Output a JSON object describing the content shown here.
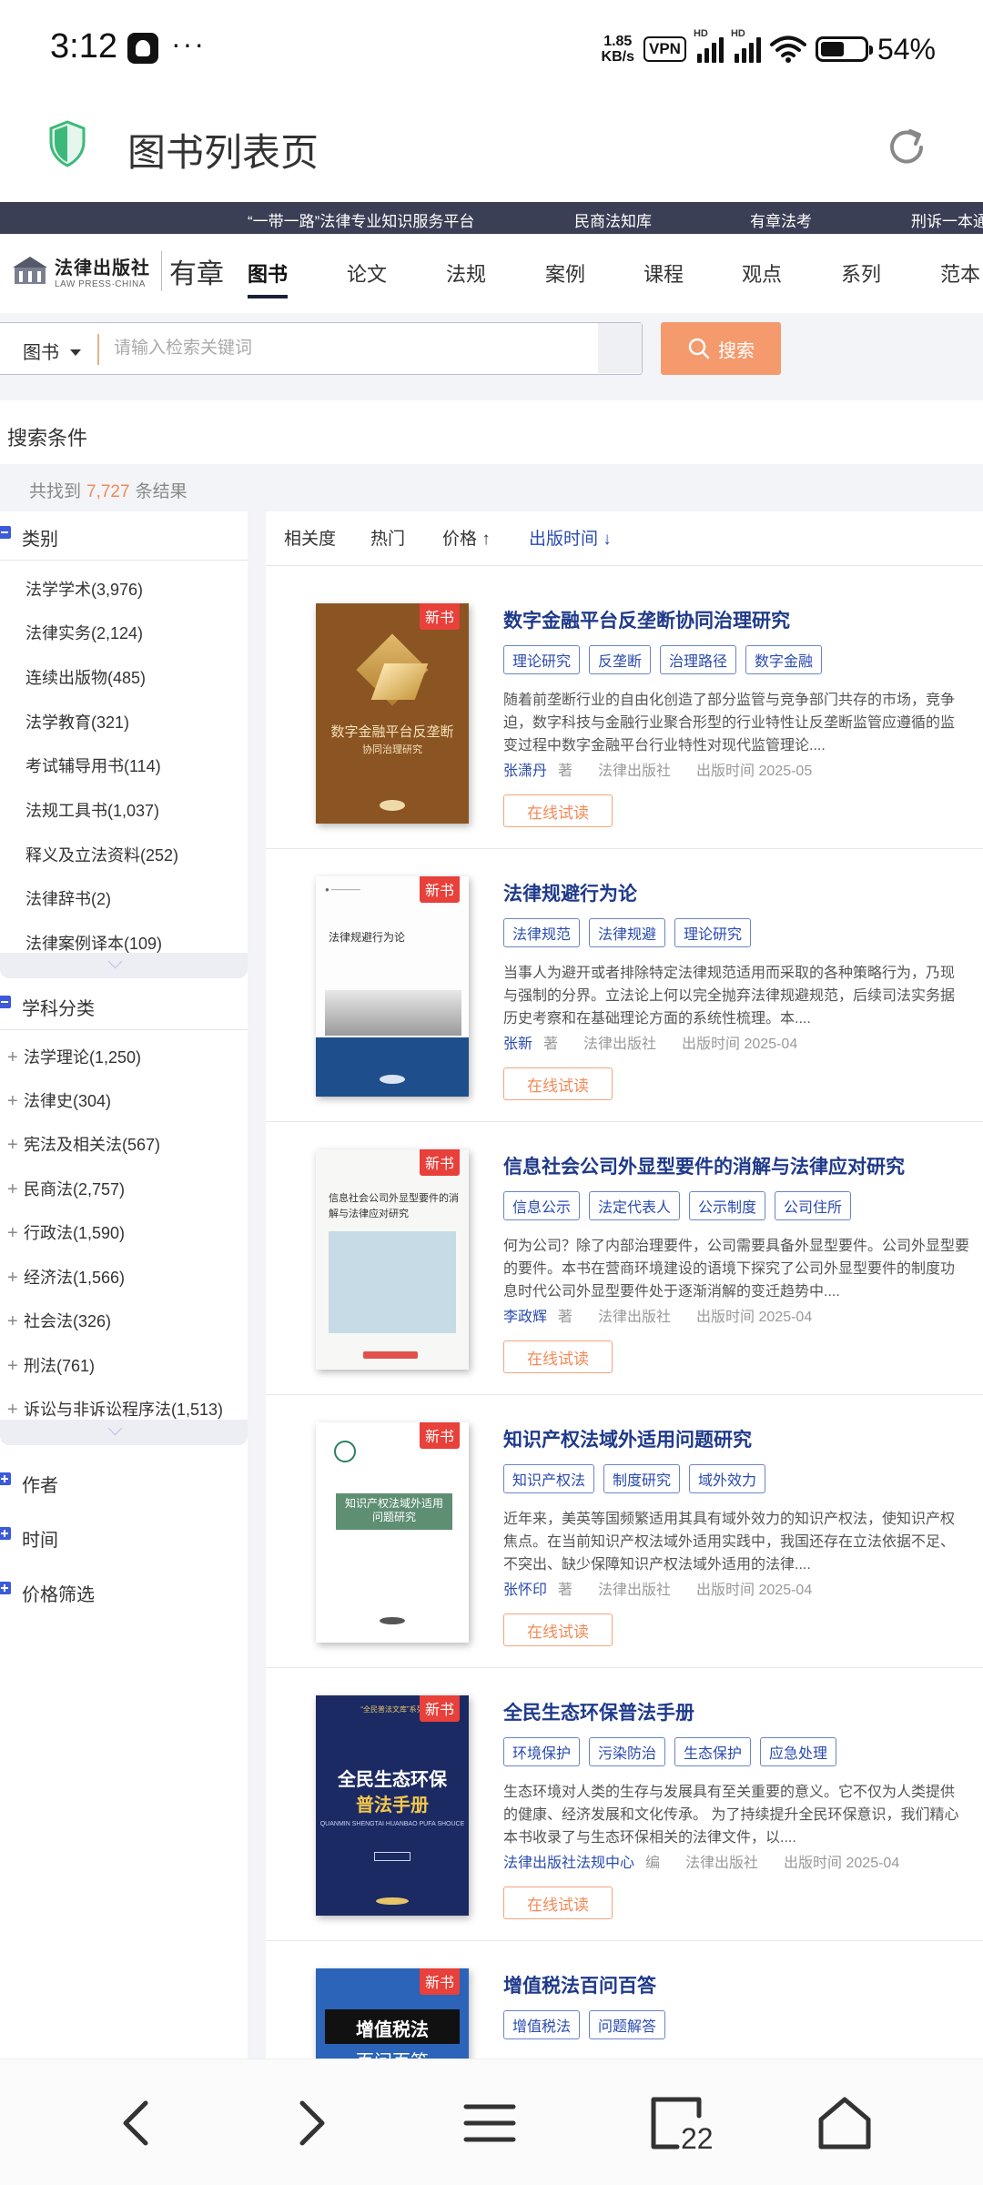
{
  "status_bar": {
    "time": "3:12",
    "dots": "···",
    "speed_value": "1.85",
    "speed_unit": "KB/s",
    "vpn": "VPN",
    "sig_label": "HD",
    "battery": "54%",
    "battery_level": 0.54
  },
  "browser": {
    "title": "图书列表页"
  },
  "top_strip": {
    "links": [
      "“一带一路”法律专业知识服务平台",
      "民商法知库",
      "有章法考",
      "刑诉一本通"
    ]
  },
  "logo": {
    "main": "法律出版社",
    "sub": "LAW PRESS·CHINA",
    "brand": "有章"
  },
  "nav": {
    "tabs": [
      "图书",
      "论文",
      "法规",
      "案例",
      "课程",
      "观点",
      "系列",
      "范本"
    ]
  },
  "search": {
    "type": "图书",
    "placeholder": "请输入检索关键词",
    "button": "搜索"
  },
  "conditions": {
    "label": "搜索条件",
    "result_prefix": "共找到",
    "result_count": "7,727",
    "result_suffix": "条结果"
  },
  "sidebar": {
    "category_title": "类别",
    "categories": [
      "法学学术(3,976)",
      "法律实务(2,124)",
      "连续出版物(485)",
      "法学教育(321)",
      "考试辅导用书(114)",
      "法规工具书(1,037)",
      "释义及立法资料(252)",
      "法律辞书(2)",
      "法律案例译本(109)"
    ],
    "discipline_title": "学科分类",
    "disciplines": [
      "法学理论(1,250)",
      "法律史(304)",
      "宪法及相关法(567)",
      "民商法(2,757)",
      "行政法(1,590)",
      "经济法(1,566)",
      "社会法(326)",
      "刑法(761)",
      "诉讼与非诉讼程序法(1,513)"
    ],
    "plus": "+",
    "author_title": "作者",
    "time_title": "时间",
    "price_title": "价格筛选"
  },
  "sort": {
    "relevance": "相关度",
    "popular": "热门",
    "price": "价格 ↑",
    "date": "出版时间 ↓"
  },
  "labels": {
    "new": "新书",
    "try": "在线试读"
  },
  "books": [
    {
      "title": "数字金融平台反垄断协同治理研究",
      "tags": [
        "理论研究",
        "反垄断",
        "治理路径",
        "数字金融"
      ],
      "desc": [
        "随着前垄断行业的自由化创造了部分监管与竞争部门共存的市场，竞争",
        "迫，数字科技与金融行业聚合形型的行业特性让反垄断监管应遵循的监",
        "变过程中数字金融平台行业特性对现代监管理论...."
      ],
      "author": "张潇丹",
      "role": "著",
      "publisher": "法律出版社",
      "date": "出版时间  2025-05",
      "cover_title": "数字金融平台反垄断",
      "cover_sub": "协同治理研究"
    },
    {
      "title": "法律规避行为论",
      "tags": [
        "法律规范",
        "法律规避",
        "理论研究"
      ],
      "desc": [
        "当事人为避开或者排除特定法律规范适用而采取的各种策略行为，乃现",
        "与强制的分界。立法论上何以完全抛弃法律规避规范，后续司法实务据",
        "历史考察和在基础理论方面的系统性梳理。本...."
      ],
      "author": "张新",
      "role": "著",
      "publisher": "法律出版社",
      "date": "出版时间  2025-04",
      "cover_title": "法律规避行为论"
    },
    {
      "title": "信息社会公司外显型要件的消解与法律应对研究",
      "tags": [
        "信息公示",
        "法定代表人",
        "公示制度",
        "公司住所"
      ],
      "desc": [
        "何为公司？除了内部治理要件，公司需要具备外显型要件。公司外显型要",
        "的要件。本书在营商环境建设的语境下探究了公司外显型要件的制度功",
        "息时代公司外显型要件处于逐渐消解的变迁趋势中...."
      ],
      "author": "李政辉",
      "role": "著",
      "publisher": "法律出版社",
      "date": "出版时间  2025-04",
      "cover_title": "信息社会公司外显型要件的消解与法律应对研究"
    },
    {
      "title": "知识产权法域外适用问题研究",
      "tags": [
        "知识产权法",
        "制度研究",
        "域外效力"
      ],
      "desc": [
        "近年来，美英等国频繁适用其具有域外效力的知识产权法，使知识产权",
        "焦点。在当前知识产权法域外适用实践中，我国还存在立法依据不足、",
        "不突出、缺少保障知识产权法域外适用的法律...."
      ],
      "author": "张怀印",
      "role": "著",
      "publisher": "法律出版社",
      "date": "出版时间  2025-04",
      "cover_title": "知识产权法域外适用",
      "cover_sub": "问题研究"
    },
    {
      "title": "全民生态环保普法手册",
      "tags": [
        "环境保护",
        "污染防治",
        "生态保护",
        "应急处理"
      ],
      "desc": [
        "生态环境对人类的生存与发展具有至关重要的意义。它不仅为人类提供",
        "的健康、经济发展和文化传承。 为了持续提升全民环保意识，我们精心",
        "本书收录了与生态环保相关的法律文件，以...."
      ],
      "author": "法律出版社法规中心",
      "role": "编",
      "publisher": "法律出版社",
      "date": "出版时间  2025-04",
      "cover_top": "“全民普法文库”系列",
      "cover_title": "全民生态环保",
      "cover_sub": "普法手册",
      "cover_pinyin": "QUANMIN SHENGTAI HUANBAO PUFA SHOUCE"
    },
    {
      "title": "增值税法百问百答",
      "tags": [
        "增值税法",
        "问题解答"
      ],
      "cover_title": "增值税法",
      "cover_sub": "百问百答"
    }
  ],
  "bottom_nav": {
    "tab_count": "22"
  }
}
